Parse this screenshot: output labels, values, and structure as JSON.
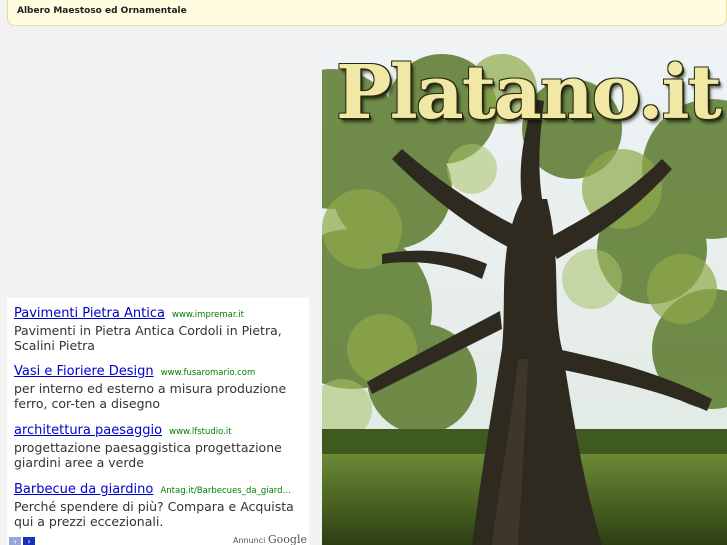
{
  "header": {
    "tagline": "Albero Maestoso ed Ornamentale"
  },
  "site": {
    "logo_text": "Platano.it"
  },
  "ads": {
    "items": [
      {
        "title": "Pavimenti Pietra Antica",
        "url": "www.impremar.it",
        "desc": "Pavimenti in Pietra Antica Cordoli in Pietra, Scalini Pietra"
      },
      {
        "title": "Vasi e Fioriere Design",
        "url": "www.fusaromario.com",
        "desc": "per interno ed esterno a misura produzione ferro, cor-ten a disegno"
      },
      {
        "title": "architettura paesaggio",
        "url": "www.lfstudio.it",
        "desc": "progettazione paesaggistica progettazione giardini aree a verde"
      },
      {
        "title": "Barbecue da giardino",
        "url": "Antag.it/Barbecues_da_giard…",
        "desc": "Perché spendere di più? Compara e Acquista qui a prezzi eccezionali."
      }
    ],
    "footer_label": "Annunci",
    "footer_brand": "Google",
    "prev_icon": "‹",
    "next_icon": "›"
  }
}
